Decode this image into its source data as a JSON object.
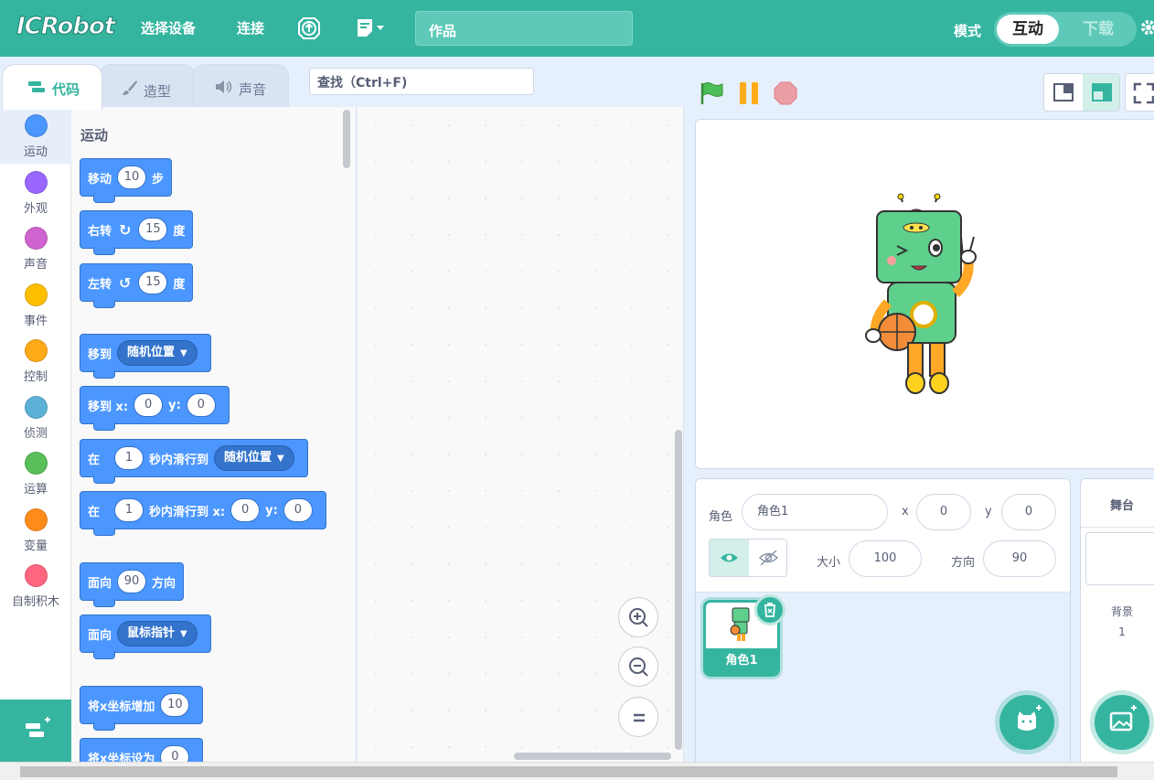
{
  "header": {
    "logo": "ICRobot",
    "menu_select_device": "选择设备",
    "menu_connect": "连接",
    "project_title": "作品",
    "mode_label": "模式",
    "mode_interactive": "互动",
    "mode_download": "下载"
  },
  "tabs": [
    {
      "label": "代码",
      "icon": "code-icon"
    },
    {
      "label": "造型",
      "icon": "brush-icon"
    },
    {
      "label": "声音",
      "icon": "speaker-icon"
    }
  ],
  "search": {
    "placeholder": "查找（Ctrl+F)"
  },
  "categories": [
    {
      "label": "运动",
      "color": "#4c97ff"
    },
    {
      "label": "外观",
      "color": "#9966ff"
    },
    {
      "label": "声音",
      "color": "#cf63cf"
    },
    {
      "label": "事件",
      "color": "#ffbf00"
    },
    {
      "label": "控制",
      "color": "#ffab19"
    },
    {
      "label": "侦测",
      "color": "#5cb1d6"
    },
    {
      "label": "运算",
      "color": "#59c059"
    },
    {
      "label": "变量",
      "color": "#ff8c1a"
    },
    {
      "label": "自制积木",
      "color": "#ff6680"
    }
  ],
  "palette": {
    "section_title": "运动",
    "blocks": {
      "move": {
        "t1": "移动",
        "v1": "10",
        "t2": "步"
      },
      "turn_right": {
        "t1": "右转",
        "v1": "15",
        "t2": "度"
      },
      "turn_left": {
        "t1": "左转",
        "v1": "15",
        "t2": "度"
      },
      "goto": {
        "t1": "移到",
        "d1": "随机位置"
      },
      "goto_xy": {
        "t1": "移到 x:",
        "v1": "0",
        "t2": "y:",
        "v2": "0"
      },
      "glide": {
        "t1": "在",
        "v1": "1",
        "t2": "秒内滑行到",
        "d1": "随机位置"
      },
      "glide_xy": {
        "t1": "在",
        "v1": "1",
        "t2": "秒内滑行到 x:",
        "v2": "0",
        "t3": "y:",
        "v3": "0"
      },
      "point_dir": {
        "t1": "面向",
        "v1": "90",
        "t2": "方向"
      },
      "point_towards": {
        "t1": "面向",
        "d1": "鼠标指针"
      },
      "change_x": {
        "t1": "将x坐标增加",
        "v1": "10"
      },
      "set_x": {
        "t1": "将x坐标设为",
        "v1": "0"
      }
    }
  },
  "sprite": {
    "label_sprite": "角色",
    "name": "角色1",
    "label_x": "x",
    "x": "0",
    "label_y": "y",
    "y": "0",
    "label_size": "大小",
    "size": "100",
    "label_direction": "方向",
    "direction": "90",
    "card_name": "角色1"
  },
  "stage_panel": {
    "title": "舞台",
    "backdrop_label": "背景",
    "backdrop_count": "1"
  },
  "colors": {
    "brand": "#35b5a0",
    "motion": "#4c97ff"
  }
}
